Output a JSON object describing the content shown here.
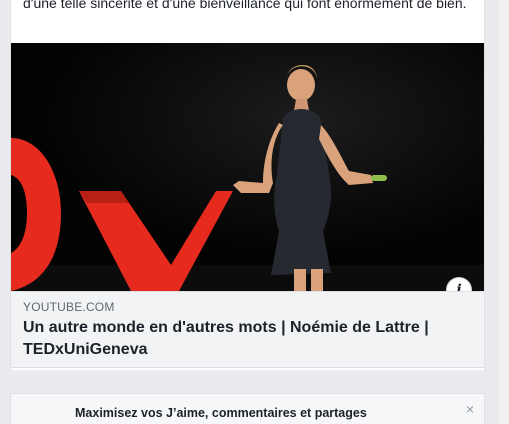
{
  "post": {
    "text": "d'une telle sincérité et d'une bienveillance qui font énormément de bien."
  },
  "link": {
    "domain": "YOUTUBE.COM",
    "title": "Un autre monde en d'autres mots | Noémie de Lattre | TEDxUniGeneva",
    "info_icon": "info-icon"
  },
  "banner": {
    "text": "Maximisez vos J’aime, commentaires et partages",
    "close_icon": "close-icon",
    "close_glyph": "×"
  },
  "colors": {
    "card_bg": "#ffffff",
    "meta_bg": "#f2f3f5",
    "ted_red": "#e62b1e",
    "page_bg": "#e9ebee"
  }
}
